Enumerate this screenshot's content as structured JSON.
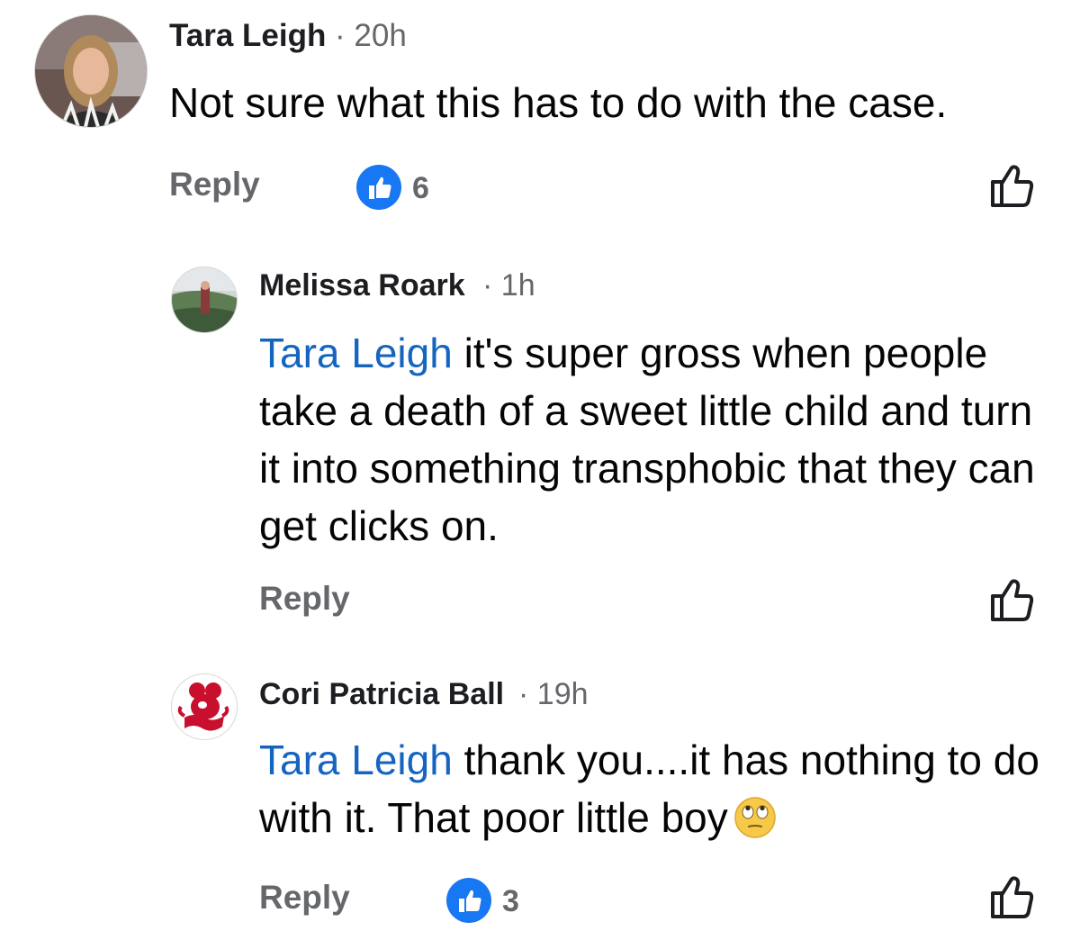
{
  "comments": [
    {
      "author": "Tara Leigh",
      "time": "20h",
      "mention": "",
      "text": "Not sure what this has to do with the case.",
      "reply_label": "Reply",
      "reaction_count": "6"
    },
    {
      "author": "Melissa Roark",
      "time": "1h",
      "mention": "Tara Leigh",
      "text": " it's super gross when people take a death of a sweet little child and turn it into something transphobic that they can get clicks on.",
      "reply_label": "Reply",
      "reaction_count": ""
    },
    {
      "author": "Cori Patricia Ball",
      "time": "19h",
      "mention": "Tara Leigh",
      "text": " thank you....it has nothing to do with it. That poor little boy",
      "emoji": "face-with-rolling-eyes-emoji",
      "reply_label": "Reply",
      "reaction_count": "3"
    }
  ],
  "separator": "·",
  "colors": {
    "mention": "#1565c0",
    "like_badge": "#1877f2",
    "secondary_text": "#65676b"
  }
}
